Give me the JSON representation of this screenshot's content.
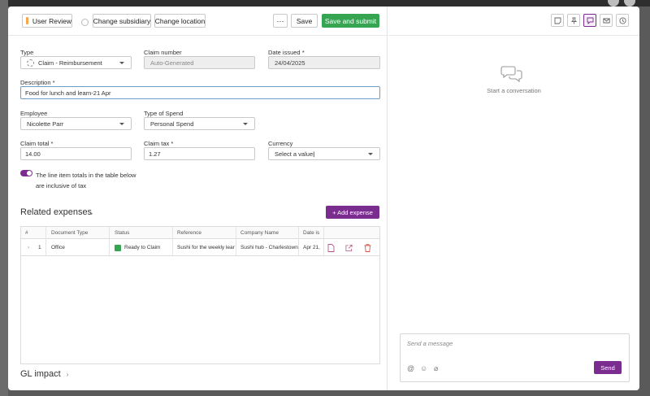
{
  "toolbar": {
    "review_label": "User Review",
    "change_subsidiary": "Change subsidiary",
    "change_location": "Change location",
    "more": "···",
    "save": "Save",
    "save_submit": "Save and submit"
  },
  "form": {
    "type_label": "Type",
    "type_value": "Claim - Reimbursement",
    "claim_number_label": "Claim number",
    "claim_number_value": "Auto-Generated",
    "date_issued_label": "Date issued *",
    "date_issued_value": "24/04/2025",
    "description_label": "Description *",
    "description_value": "Food for lunch and learn-21 Apr",
    "employee_label": "Employee",
    "employee_value": "Nicolette Parr",
    "type_of_spend_label": "Type of Spend",
    "type_of_spend_value": "Personal Spend",
    "claim_total_label": "Claim total *",
    "claim_total_value": "14.00",
    "claim_tax_label": "Claim tax *",
    "claim_tax_value": "1.27",
    "currency_label": "Currency",
    "currency_placeholder": "Select a value",
    "inclusive_tax_label": "The line item totals in the table below are inclusive of tax",
    "inclusive_tax_on": true
  },
  "expenses": {
    "title": "Related expenses",
    "add_button": "+ Add expense",
    "columns": [
      "#",
      "Document Type",
      "Status",
      "Reference",
      "Company Name",
      "Date is"
    ],
    "rows": [
      {
        "num": "1",
        "doc_type": "Office",
        "status": "Ready to Claim",
        "reference": "Sushi for the weekly lear",
        "company": "Sushi hub - Charlestown",
        "date": "Apr 21,"
      }
    ]
  },
  "gl_impact": {
    "title": "GL impact"
  },
  "chat": {
    "empty_text": "Start a conversation",
    "input_placeholder": "Send a message",
    "send": "Send"
  },
  "colors": {
    "accent": "#7b2c8f",
    "success": "#35a552",
    "review": "#f4a74f"
  },
  "icons": {
    "right_toolbar": [
      "note-icon",
      "pin-icon",
      "chat-icon",
      "mail-icon",
      "clock-icon"
    ],
    "composer": [
      "mention-icon",
      "emoji-icon",
      "attach-icon"
    ]
  }
}
